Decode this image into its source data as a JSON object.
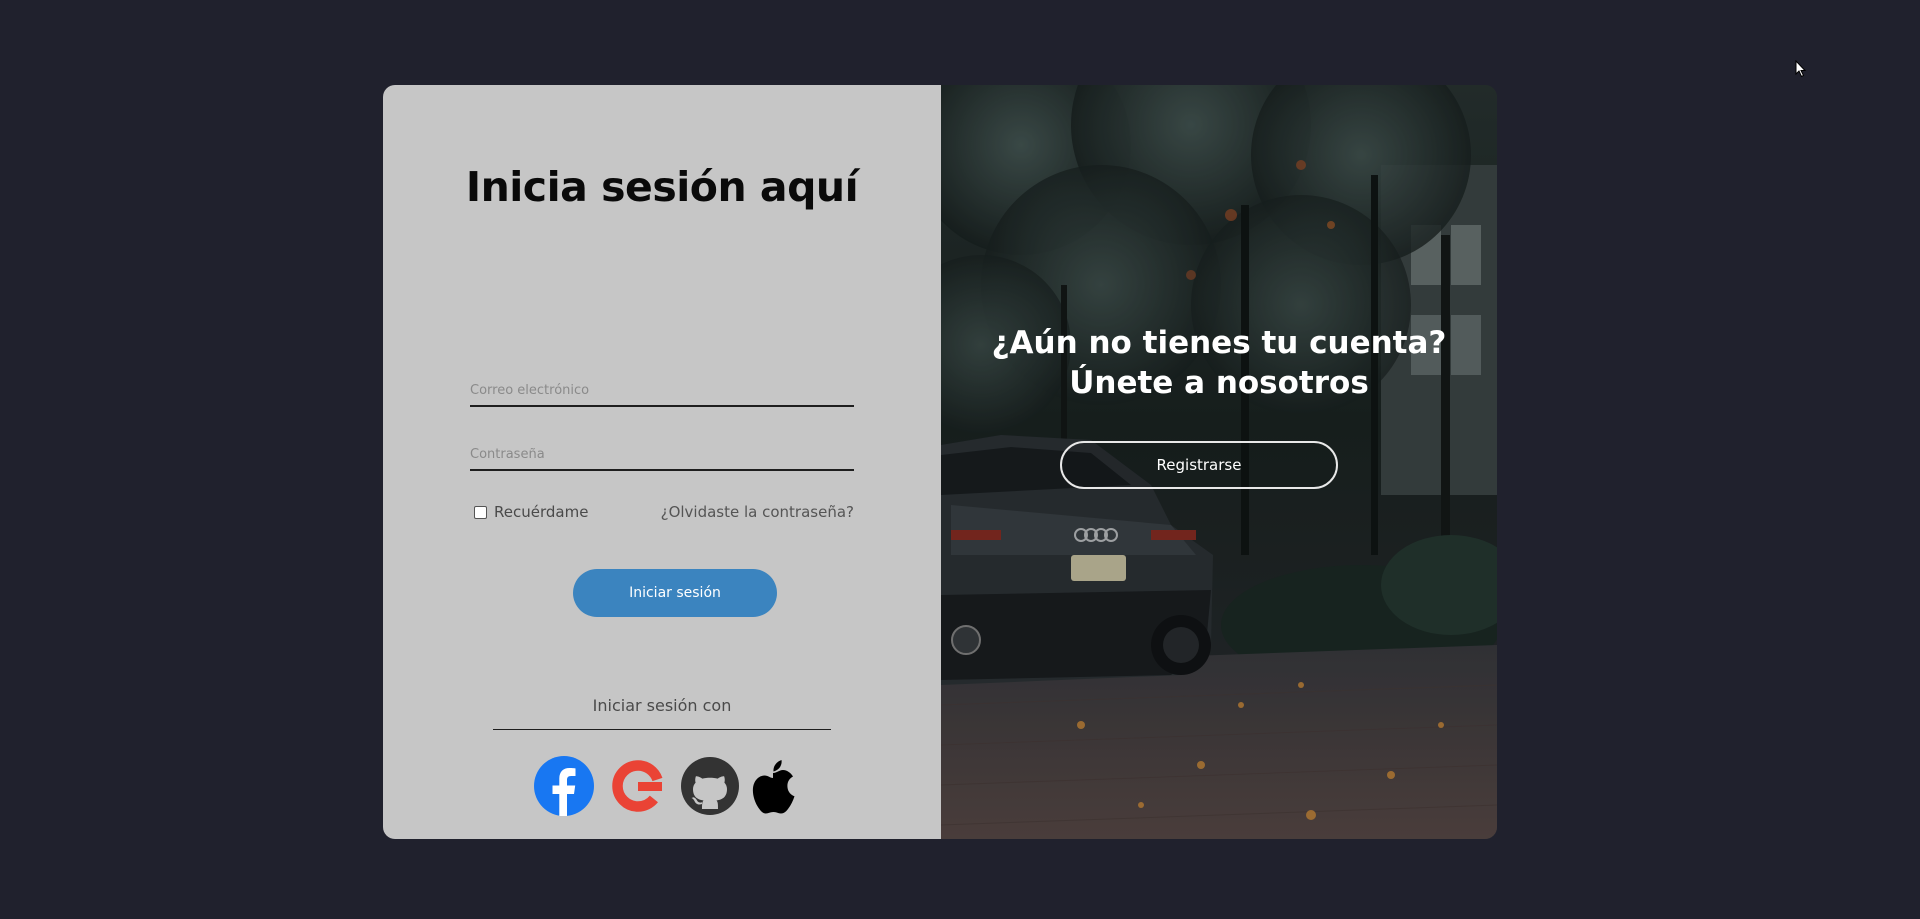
{
  "login": {
    "title": "Inicia sesión aquí",
    "email_placeholder": "Correo electrónico",
    "password_placeholder": "Contraseña",
    "remember_label": "Recuérdame",
    "forgot_link": "¿Olvidaste la contraseña?",
    "submit_label": "Iniciar sesión",
    "social_heading": "Iniciar sesión con",
    "social_icons": [
      "facebook-icon",
      "google-icon",
      "github-icon",
      "apple-icon"
    ]
  },
  "signup": {
    "line1": "¿Aún no tienes tu cuenta?",
    "line2": "Únete a nosotros",
    "button_label": "Registrarse"
  },
  "colors": {
    "page_background": "#20212d",
    "left_panel": "#c6c6c6",
    "primary_button": "#3b84bf",
    "facebook": "#1877f2",
    "google": "#ea4335",
    "github": "#333333"
  }
}
